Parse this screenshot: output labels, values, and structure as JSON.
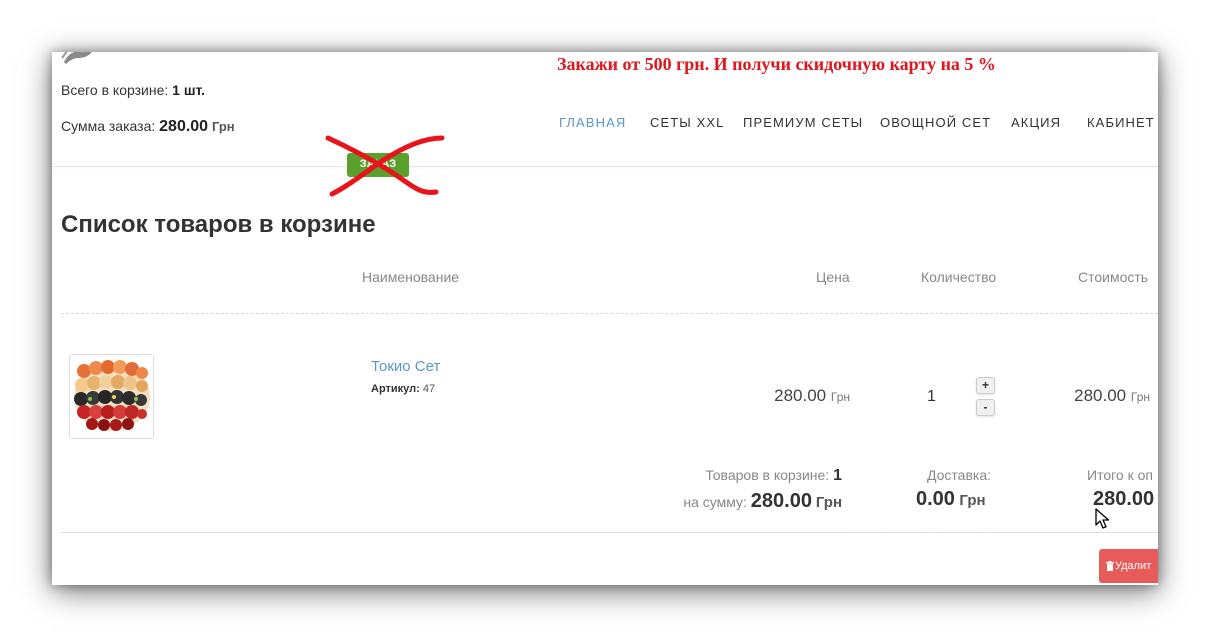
{
  "header": {
    "cart_count_label": "Всего в корзине:",
    "cart_count_value": "1 шт.",
    "cart_sum_label": "Сумма заказа:",
    "cart_sum_value": "280.00",
    "currency": "Грн",
    "promo": "Закажи от 500 грн. И получи скидочную карту на 5 %",
    "order_button": "ЗАКАЗ"
  },
  "nav": {
    "items": [
      {
        "label": "ГЛАВНАЯ",
        "active": true
      },
      {
        "label": "СЕТЫ XXL"
      },
      {
        "label": "ПРЕМИУМ СЕТЫ"
      },
      {
        "label": "ОВОЩНОЙ СЕТ"
      },
      {
        "label": "АКЦИЯ"
      },
      {
        "label": "КАБИНЕТ",
        "dropdown": true
      }
    ]
  },
  "cart": {
    "title": "Список товаров в корзине",
    "columns": {
      "name": "Наименование",
      "price": "Цена",
      "quantity": "Количество",
      "cost": "Стоимость"
    },
    "items": [
      {
        "name": "Токио Сет",
        "sku_label": "Артикул:",
        "sku": "47",
        "price": "280.00",
        "currency": "Грн",
        "quantity": "1",
        "plus": "+",
        "minus": "-",
        "total": "280.00"
      }
    ],
    "summary": {
      "count_label": "Товаров в корзине:",
      "count": "1",
      "amount_label": "на сумму:",
      "amount": "280.00",
      "currency": "Грн",
      "delivery_label": "Доставка:",
      "delivery": "0.00",
      "grand_label": "Итого к оп",
      "grand": "280.00"
    },
    "delete_button": "Удалит"
  },
  "colors": {
    "accent": "#5b97c9",
    "promo": "#e0161d",
    "delete": "#e85b5b",
    "order_button": "#5aa02c"
  }
}
